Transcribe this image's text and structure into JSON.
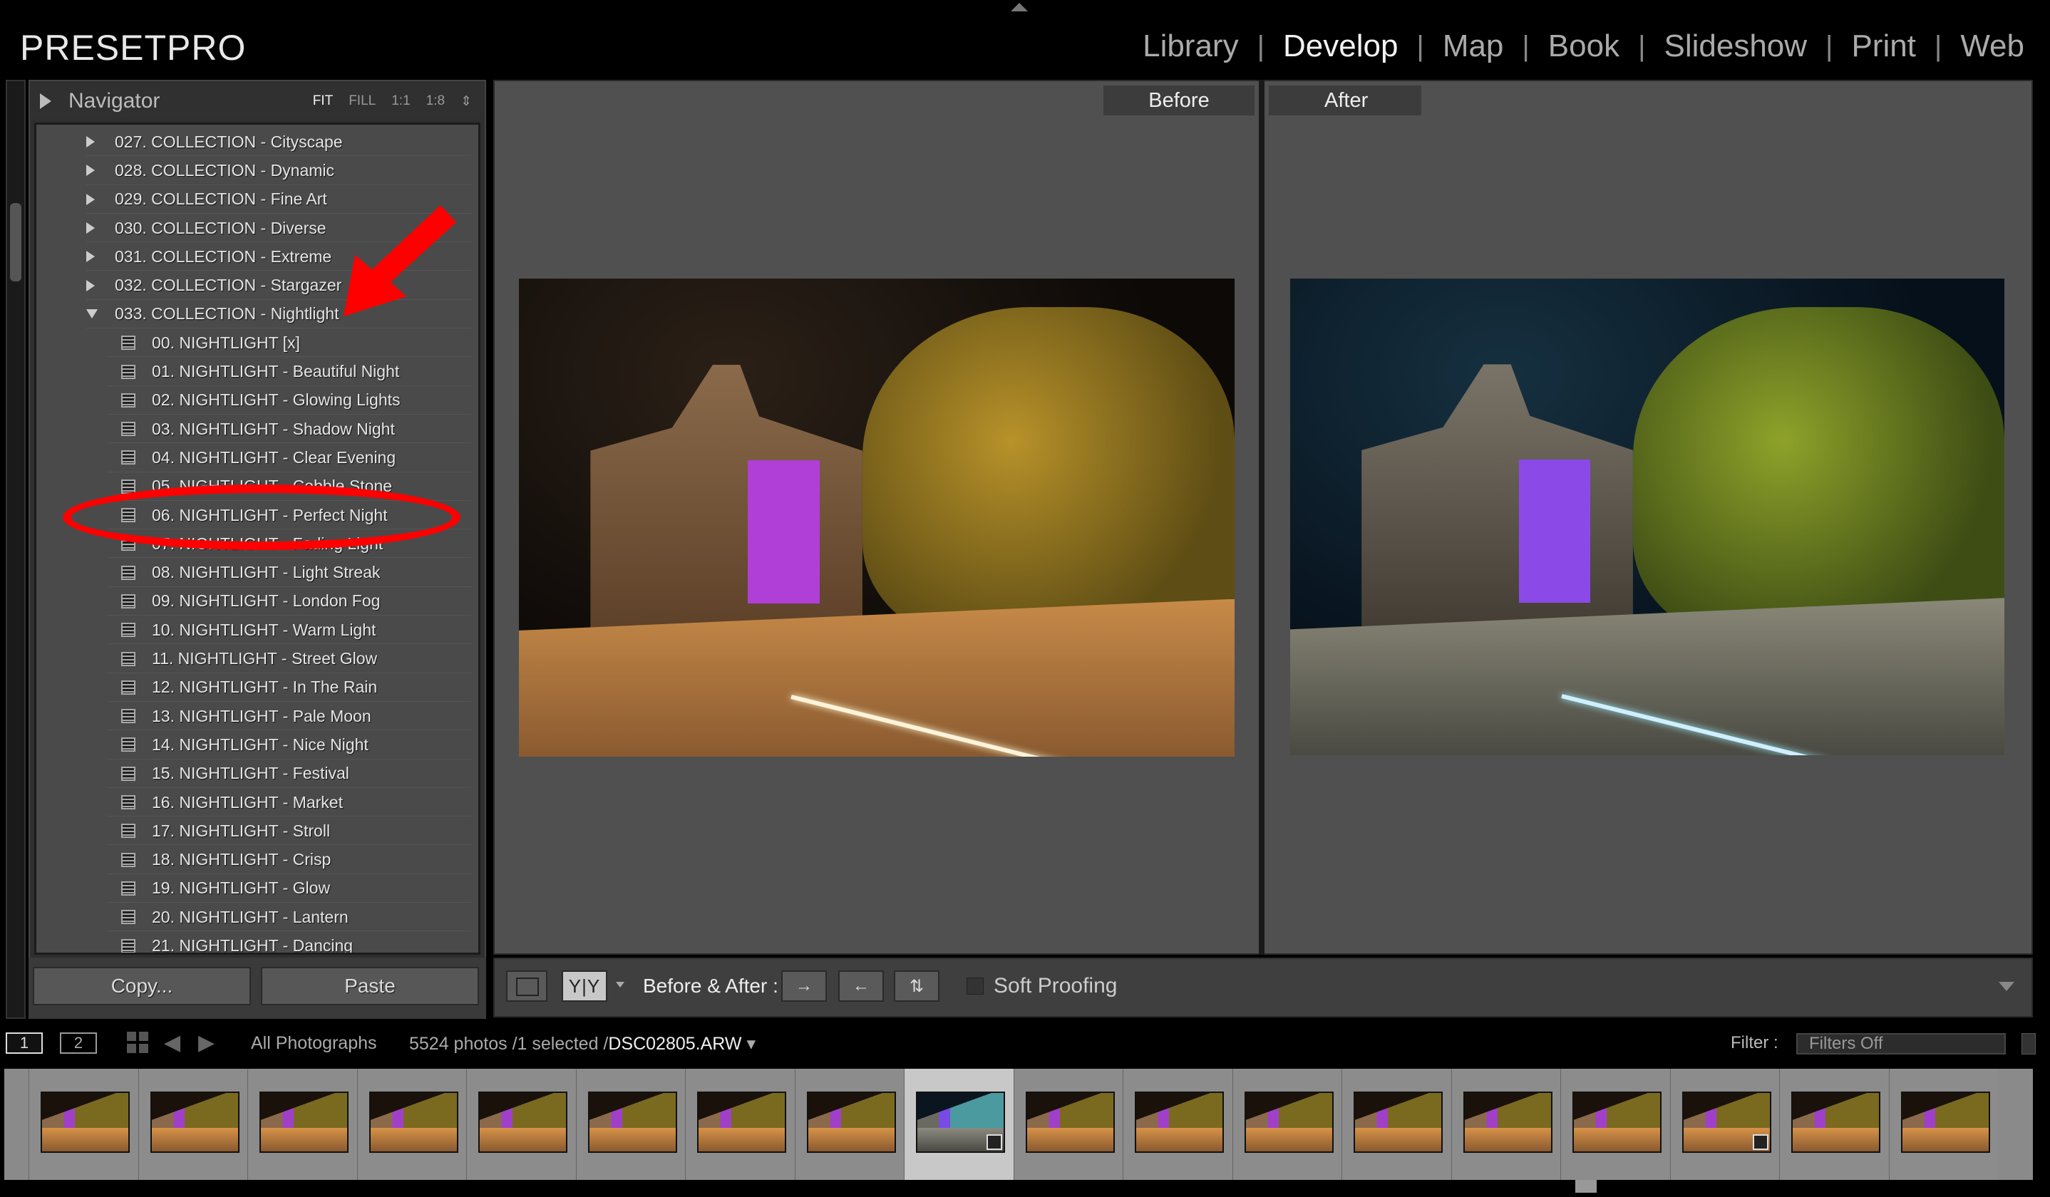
{
  "app": {
    "brand": "PRESETPRO"
  },
  "modules": [
    {
      "label": "Library",
      "active": false
    },
    {
      "label": "Develop",
      "active": true
    },
    {
      "label": "Map",
      "active": false
    },
    {
      "label": "Book",
      "active": false
    },
    {
      "label": "Slideshow",
      "active": false
    },
    {
      "label": "Print",
      "active": false
    },
    {
      "label": "Web",
      "active": false
    }
  ],
  "navigator": {
    "title": "Navigator",
    "zooms": [
      "FIT",
      "FILL",
      "1:1",
      "1:8"
    ],
    "active_zoom": "FIT"
  },
  "collections": [
    {
      "label": "027. COLLECTION - Cityscape",
      "expanded": false
    },
    {
      "label": "028. COLLECTION - Dynamic",
      "expanded": false
    },
    {
      "label": "029. COLLECTION - Fine Art",
      "expanded": false
    },
    {
      "label": "030. COLLECTION - Diverse",
      "expanded": false
    },
    {
      "label": "031. COLLECTION - Extreme",
      "expanded": false
    },
    {
      "label": "032. COLLECTION - Stargazer",
      "expanded": false
    },
    {
      "label": "033. COLLECTION - Nightlight",
      "expanded": true
    }
  ],
  "presets": [
    "00. NIGHTLIGHT [x]",
    "01. NIGHTLIGHT - Beautiful Night",
    "02. NIGHTLIGHT - Glowing Lights",
    "03. NIGHTLIGHT - Shadow Night",
    "04. NIGHTLIGHT - Clear Evening",
    "05. NIGHTLIGHT - Cobble Stone",
    "06. NIGHTLIGHT - Perfect Night",
    "07. NIGHTLIGHT - Fading Light",
    "08. NIGHTLIGHT - Light Streak",
    "09. NIGHTLIGHT - London Fog",
    "10. NIGHTLIGHT - Warm Light",
    "11. NIGHTLIGHT - Street Glow",
    "12. NIGHTLIGHT - In The Rain",
    "13. NIGHTLIGHT - Pale Moon",
    "14. NIGHTLIGHT - Nice Night",
    "15. NIGHTLIGHT - Festival",
    "16. NIGHTLIGHT - Market",
    "17. NIGHTLIGHT - Stroll",
    "18. NIGHTLIGHT - Crisp",
    "19. NIGHTLIGHT - Glow",
    "20. NIGHTLIGHT - Lantern",
    "21. NIGHTLIGHT - Dancing"
  ],
  "highlighted_preset": "06. NIGHTLIGHT - Perfect Night",
  "panel_buttons": {
    "copy": "Copy...",
    "paste": "Paste"
  },
  "view": {
    "before_label": "Before",
    "after_label": "After"
  },
  "toolbar": {
    "yy": "Y|Y",
    "before_after_label": "Before & After :",
    "soft_proofing": "Soft Proofing",
    "soft_proofing_checked": false
  },
  "filmstrip_bar": {
    "pages": [
      "1",
      "2"
    ],
    "source": "All Photographs",
    "count": "5524 photos /1 selected /",
    "filename": "DSC02805.ARW",
    "filter_label": "Filter :",
    "filter_value": "Filters Off"
  },
  "filmstrip": [
    {
      "style": "warm"
    },
    {
      "style": "warm"
    },
    {
      "style": "warm"
    },
    {
      "style": "warm"
    },
    {
      "style": "warm"
    },
    {
      "style": "warm"
    },
    {
      "style": "warm"
    },
    {
      "style": "warm"
    },
    {
      "style": "cool",
      "selected": true,
      "badge": true
    },
    {
      "style": "warm"
    },
    {
      "style": "warm"
    },
    {
      "style": "warm"
    },
    {
      "style": "warm"
    },
    {
      "style": "warm"
    },
    {
      "style": "warm"
    },
    {
      "style": "warm",
      "badge": true
    },
    {
      "style": "warm"
    },
    {
      "style": "warm"
    }
  ],
  "colors": {
    "annotation": "#ff0000",
    "panel": "#4a4a4a"
  }
}
